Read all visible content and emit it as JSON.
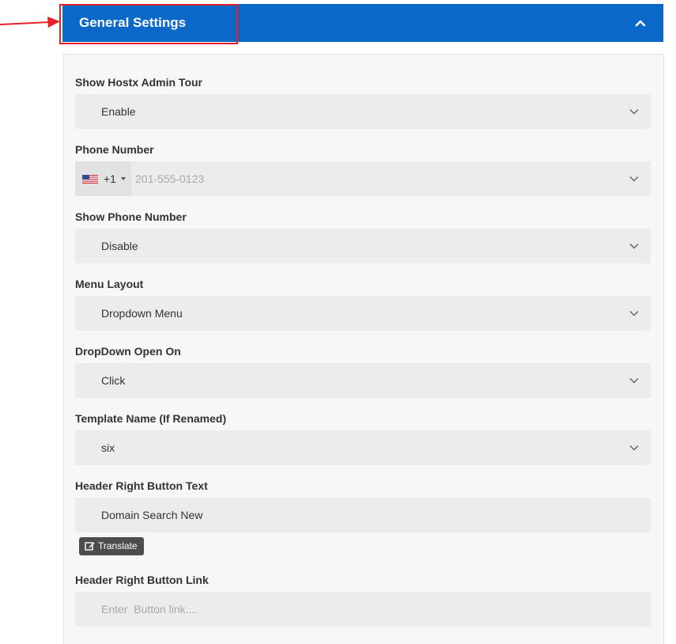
{
  "header": {
    "title": "General Settings"
  },
  "fields": {
    "admin_tour": {
      "label": "Show Hostx Admin Tour",
      "value": "Enable"
    },
    "phone": {
      "label": "Phone Number",
      "dial_code": "+1",
      "placeholder": "201-555-0123"
    },
    "show_phone": {
      "label": "Show Phone Number",
      "value": "Disable"
    },
    "menu_layout": {
      "label": "Menu Layout",
      "value": "Dropdown Menu"
    },
    "dropdown_open": {
      "label": "DropDown Open On",
      "value": "Click"
    },
    "template_name": {
      "label": "Template Name (If Renamed)",
      "value": "six"
    },
    "header_button_text": {
      "label": "Header Right Button Text",
      "value": "Domain Search New",
      "translate_label": "Translate"
    },
    "header_button_link": {
      "label": "Header Right Button Link",
      "placeholder": "Enter  Button link...."
    }
  },
  "colors": {
    "header_bg": "#0b68c9",
    "highlight": "#e8202a",
    "panel_bg": "#f7f7f7",
    "field_bg": "#ececec"
  },
  "icons": {
    "collapse": "chevron-up-icon",
    "select_arrow": "chevron-down-icon",
    "flag": "us-flag-icon",
    "translate": "edit-icon",
    "annotation": "red-arrow-icon"
  }
}
